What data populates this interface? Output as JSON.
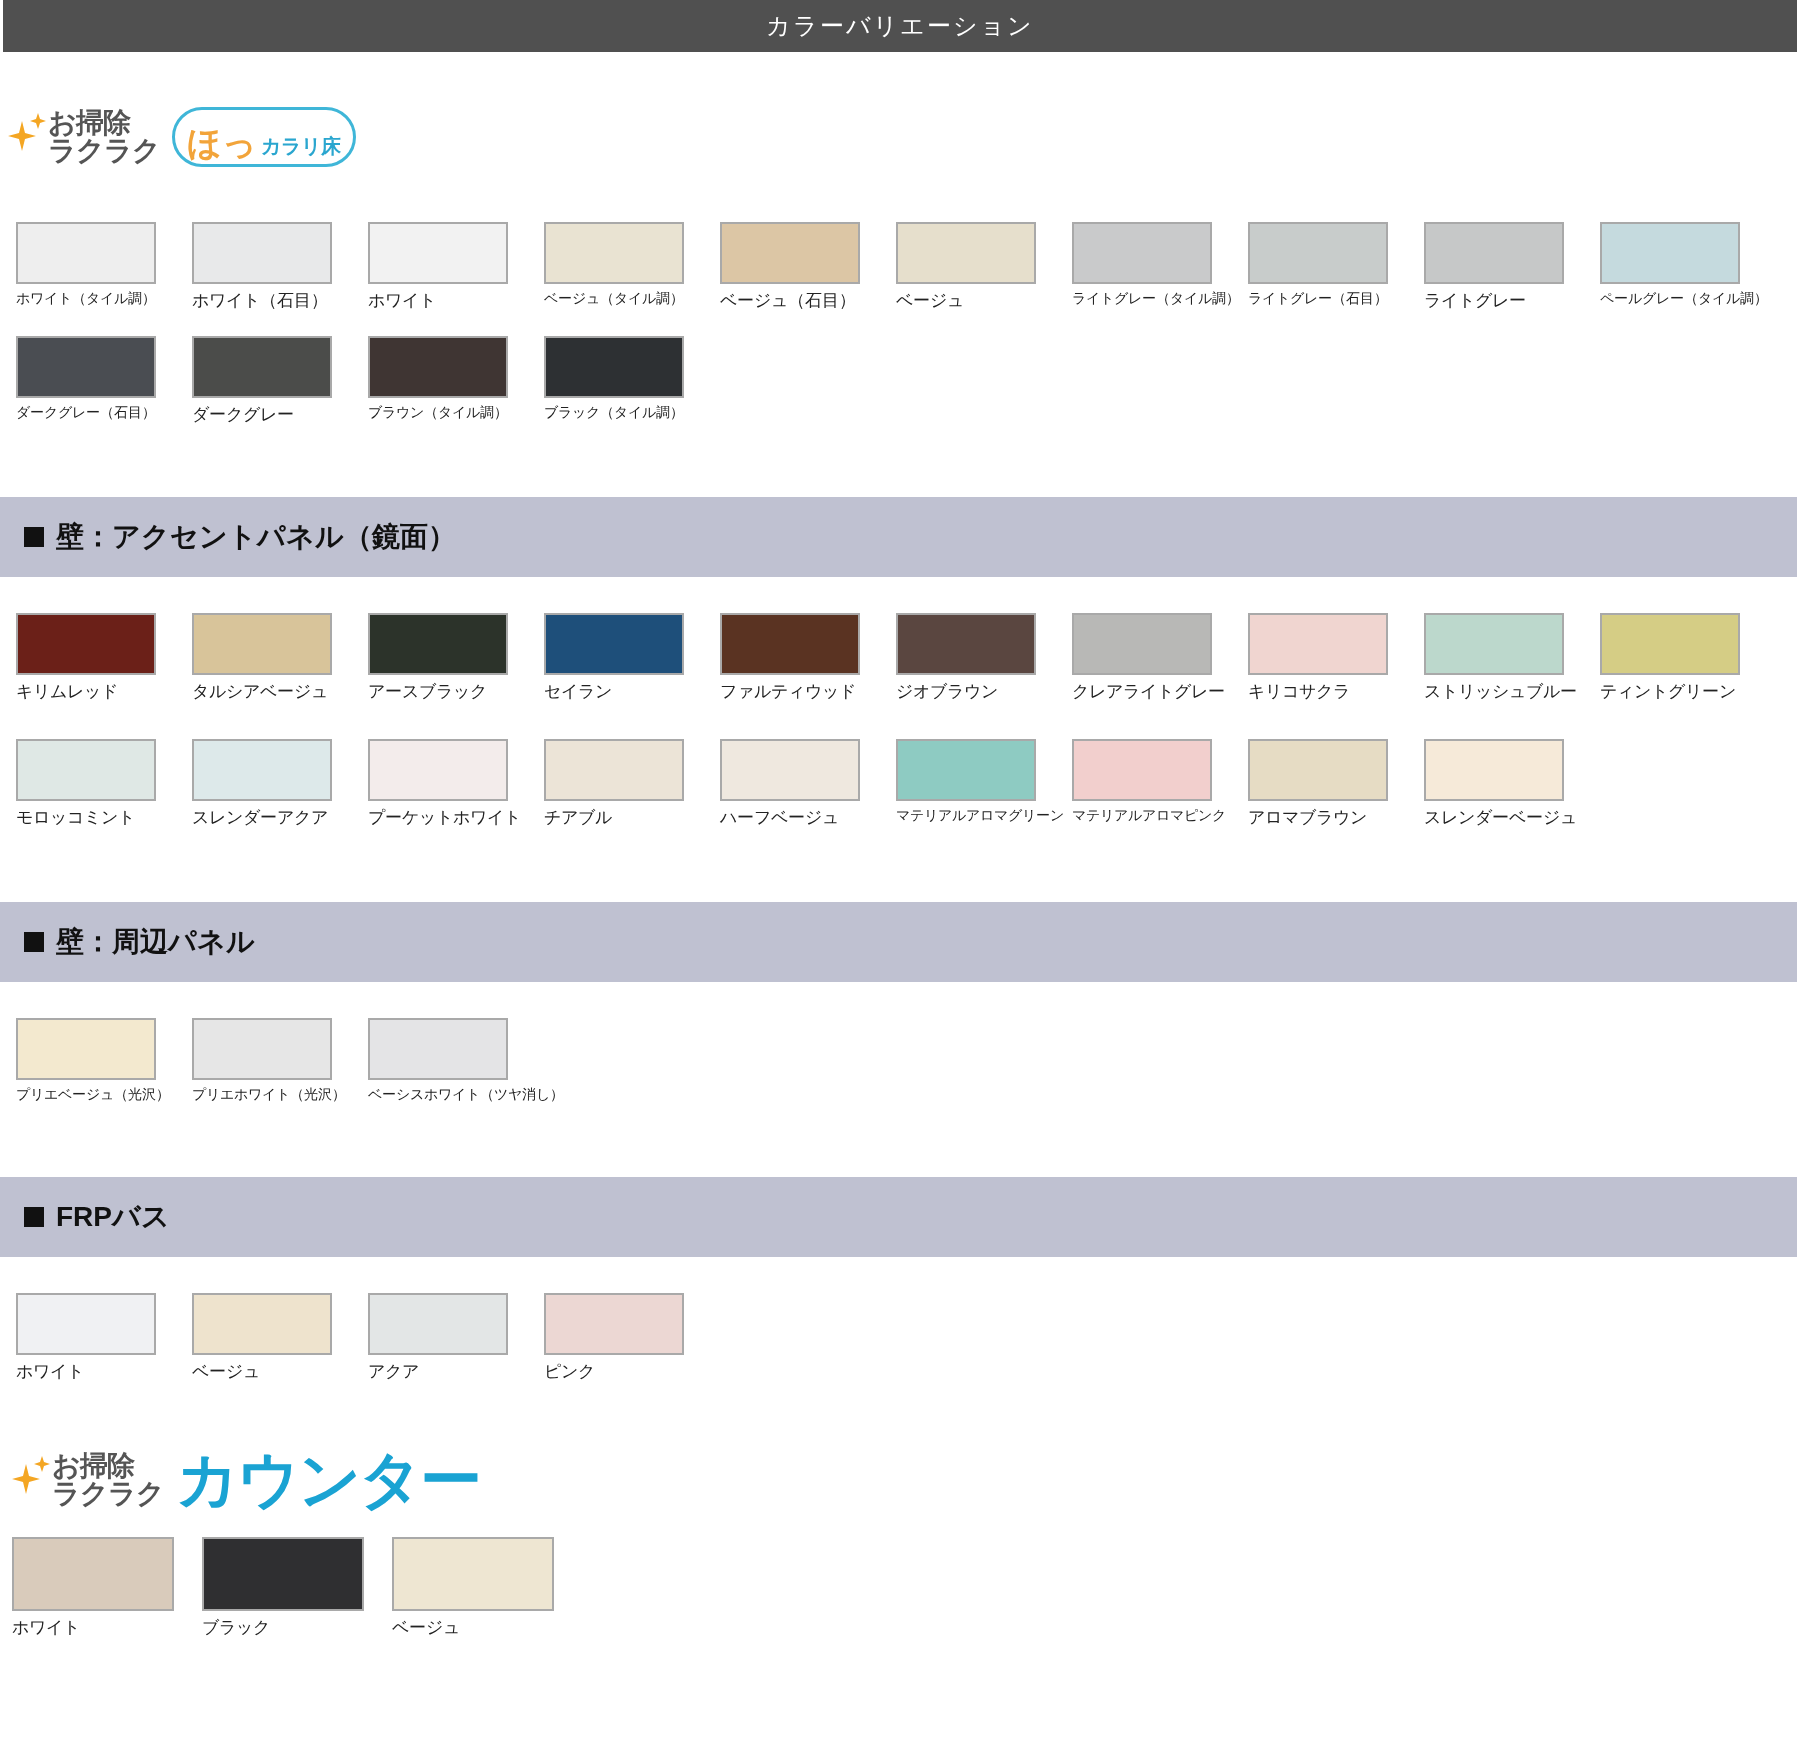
{
  "title_bar": {
    "title": "カラーバリエーション"
  },
  "floor": {
    "logo": {
      "tagline_1": "お掃除",
      "tagline_2": "ラクラク",
      "name_main": "ほっ",
      "name_sub": "カラリ床"
    },
    "swatches": [
      {
        "label": "ホワイト（タイル調）",
        "color": "#eeeeee"
      },
      {
        "label": "ホワイト（石目）",
        "color": "#e8e9ea"
      },
      {
        "label": "ホワイト",
        "color": "#f2f2f2"
      },
      {
        "label": "ベージュ（タイル調）",
        "color": "#e9e3d2"
      },
      {
        "label": "ベージュ（石目）",
        "color": "#dcc6a5"
      },
      {
        "label": "ベージュ",
        "color": "#e6dfcc"
      },
      {
        "label": "ライトグレー（タイル調）",
        "color": "#c9cacb"
      },
      {
        "label": "ライトグレー（石目）",
        "color": "#c8cccb"
      },
      {
        "label": "ライトグレー",
        "color": "#c6c8c8"
      },
      {
        "label": "ペールグレー（タイル調）",
        "color": "#c5dade"
      },
      {
        "label": "ダークグレー（石目）",
        "color": "#4a4d52"
      },
      {
        "label": "ダークグレー",
        "color": "#4b4c4a"
      },
      {
        "label": "ブラウン（タイル調）",
        "color": "#3f3533"
      },
      {
        "label": "ブラック（タイル調）",
        "color": "#2d3033"
      }
    ]
  },
  "sections": [
    {
      "heading": "壁：アクセントパネル（鏡面）",
      "swatches": [
        {
          "label": "キリムレッド",
          "color": "#6b2018"
        },
        {
          "label": "タルシアベージュ",
          "color": "#d8c49a"
        },
        {
          "label": "アースブラック",
          "color": "#2c332a"
        },
        {
          "label": "セイラン",
          "color": "#1e4f7a"
        },
        {
          "label": "ファルティウッド",
          "color": "#5a3322"
        },
        {
          "label": "ジオブラウン",
          "color": "#5a4640"
        },
        {
          "label": "クレアライトグレー",
          "color": "#b8b8b6"
        },
        {
          "label": "キリコサクラ",
          "color": "#f0d5d0"
        },
        {
          "label": "ストリッシュブルー",
          "color": "#bcd8cc"
        },
        {
          "label": "ティントグリーン",
          "color": "#d5cd85"
        },
        {
          "label": "モロッコミント",
          "color": "#dfe8e5"
        },
        {
          "label": "スレンダーアクア",
          "color": "#dde9ea"
        },
        {
          "label": "プーケットホワイト",
          "color": "#f3eceb"
        },
        {
          "label": "チアブル",
          "color": "#ece4d7"
        },
        {
          "label": "ハーフベージュ",
          "color": "#efe8df"
        },
        {
          "label": "マテリアルアロマグリーン",
          "color": "#8ecbc2"
        },
        {
          "label": "マテリアルアロマピンク",
          "color": "#f2cfcd"
        },
        {
          "label": "アロマブラウン",
          "color": "#e6dcc4"
        },
        {
          "label": "スレンダーベージュ",
          "color": "#f6ead9"
        }
      ]
    },
    {
      "heading": "壁：周辺パネル",
      "swatches": [
        {
          "label": "プリエベージュ（光沢）",
          "color": "#f3e9cf"
        },
        {
          "label": "プリエホワイト（光沢）",
          "color": "#e6e6e6"
        },
        {
          "label": "ベーシスホワイト（ツヤ消し）",
          "color": "#e4e4e6"
        }
      ]
    },
    {
      "heading": "FRPバス",
      "swatches": [
        {
          "label": "ホワイト",
          "color": "#f0f1f3"
        },
        {
          "label": "ベージュ",
          "color": "#eee3cd"
        },
        {
          "label": "アクア",
          "color": "#e3e6e6"
        },
        {
          "label": "ピンク",
          "color": "#ecd7d3"
        }
      ]
    }
  ],
  "counter": {
    "logo": {
      "tagline_1": "お掃除",
      "tagline_2": "ラクラク",
      "name": "カウンター"
    },
    "swatches": [
      {
        "label": "ホワイト",
        "color": "#d9cbbb"
      },
      {
        "label": "ブラック",
        "color": "#2f2f31"
      },
      {
        "label": "ベージュ",
        "color": "#eee6d2"
      }
    ]
  }
}
